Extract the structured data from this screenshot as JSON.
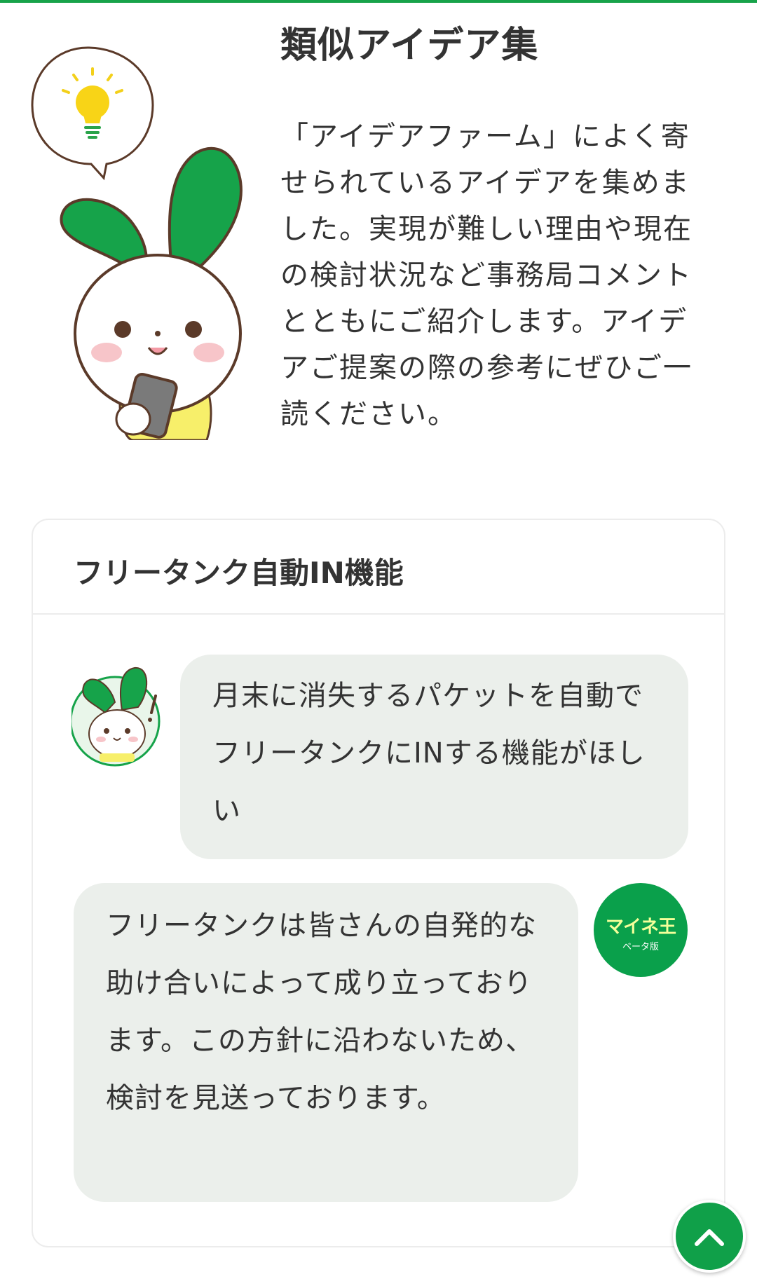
{
  "page": {
    "title": "類似アイデア集",
    "intro": "「アイデアファーム」によく寄せられているアイデアを集めました。実現が難しい理由や現在の検討状況など事務局コメントとともにご紹介します。アイデアご提案の際の参考にぜひご一読ください。"
  },
  "card": {
    "title": "フリータンク自動IN機能",
    "user_message": "月末に消失するパケットを自動でフリータンクにINする機能がほしい",
    "reply_message": "フリータンクは皆さんの自発的な助け合いによって成り立っております。この方針に沿わないため、検討を見送っております。",
    "brand_avatar": {
      "name": "マイネ王",
      "sub": "ベータ版"
    }
  },
  "icons": {
    "mascot": "rabbit-mascot-with-lightbulb-icon",
    "user_avatar": "rabbit-avatar-icon",
    "scroll_top": "chevron-up-icon"
  },
  "colors": {
    "accent": "#17a34a",
    "bubble": "#ebefeb",
    "mascot_green": "#16a34a",
    "text": "#333333"
  }
}
